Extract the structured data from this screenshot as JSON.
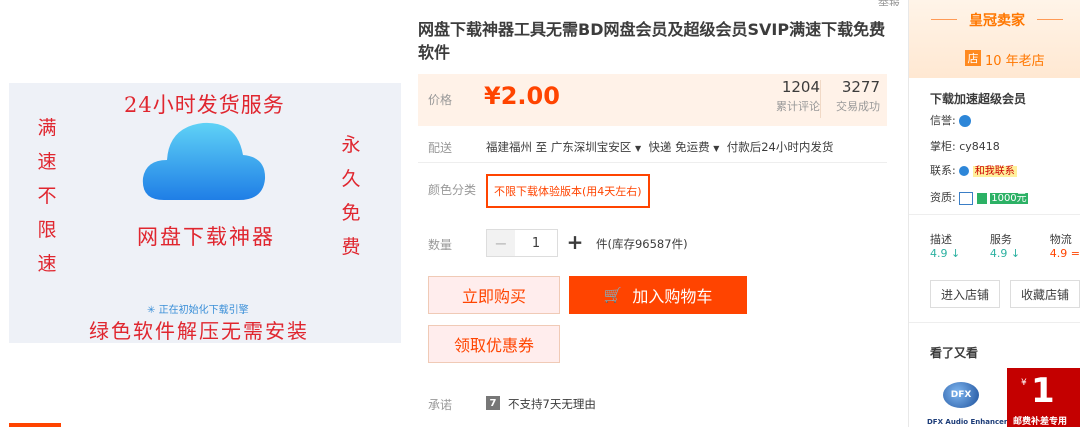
{
  "product_image": {
    "top_text": "24小时发货服务",
    "left_vertical": [
      "满",
      "速",
      "不",
      "限",
      "速"
    ],
    "right_vertical": [
      "永",
      "久",
      "免",
      "费"
    ],
    "center_text": "网盘下载神器",
    "loading_text": "正在初始化下载引擎",
    "bottom_text": "绿色软件解压无需安装"
  },
  "top_tag": "举报",
  "title": "网盘下载神器工具无需BD网盘会员及超级会员SVIP满速下载免费软件",
  "price": {
    "label": "价格",
    "value": "¥2.00",
    "reviews_count": "1204",
    "reviews_label": "累计评论",
    "deals_count": "3277",
    "deals_label": "交易成功"
  },
  "shipping": {
    "label": "配送",
    "from": "福建福州 至",
    "to": "广东深圳宝安区",
    "method": "快递 免运费",
    "note": "付款后24小时内发货"
  },
  "color": {
    "label": "颜色分类",
    "option": "不限下载体验版本(用4天左右)"
  },
  "quantity": {
    "label": "数量",
    "value": "1",
    "minus": "−",
    "plus": "+",
    "stock": "件(库存96587件)"
  },
  "buttons": {
    "buy": "立即购买",
    "cart": "加入购物车",
    "coupon": "领取优惠券"
  },
  "promise": {
    "label": "承诺",
    "badge": "7",
    "text": "不支持7天无理由"
  },
  "sidebar": {
    "crown": "皇冠卖家",
    "shop_badge": "店",
    "shop_age": "10 年老店",
    "shop_name": "下载加速超级会员",
    "reputation_label": "信誉:",
    "keeper_label": "掌柜:",
    "keeper_name": "cy8418",
    "contact_label": "联系:",
    "contact_btn": "和我联系",
    "qual_label": "资质:",
    "qual_amount": "1000元",
    "stats": [
      {
        "label": "描述",
        "value": "4.9",
        "arrow": "↓"
      },
      {
        "label": "服务",
        "value": "4.9",
        "arrow": "↓"
      },
      {
        "label": "物流",
        "value": "4.9",
        "arrow": "="
      }
    ],
    "enter_shop": "进入店铺",
    "fav_shop": "收藏店铺",
    "seen_title": "看了又看",
    "thumb1_text": "DFX Audio Enhancer",
    "thumb2_price": "1",
    "thumb2_yen": "¥",
    "thumb2_caption": "邮费补差专用"
  },
  "colors": {
    "accent": "#ff4400",
    "price": "#ff4400",
    "crown": "#ff7700",
    "teal": "#2cb1a1"
  }
}
